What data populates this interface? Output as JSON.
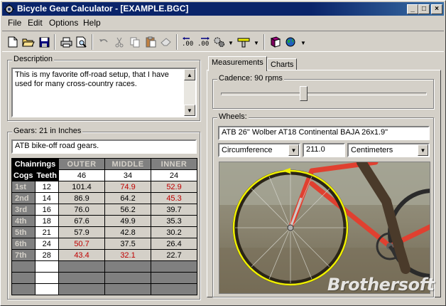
{
  "window": {
    "title": "Bicycle Gear Calculator - [EXAMPLE.BGC]"
  },
  "menu": [
    "File",
    "Edit",
    "Options",
    "Help"
  ],
  "toolbar": {
    "icons": [
      "new-icon",
      "open-folder-icon",
      "save-icon",
      "print-icon",
      "print-preview-icon",
      "undo-icon",
      "cut-icon",
      "copy-icon",
      "paste-icon",
      "eraser-icon",
      "decimal-left-icon",
      "decimal-right-icon",
      "gears-icon",
      "bicycle-icon",
      "book-icon",
      "globe-icon"
    ]
  },
  "description": {
    "label": "Description",
    "text": "This is my favorite off-road setup, that I have used for many cross-country races."
  },
  "gears": {
    "label": "Gears: 21 in Inches",
    "name": "ATB bike-off road gears.",
    "header_chainrings": "Chainrings",
    "header_cogs": "Cogs",
    "header_teeth": "Teeth",
    "chainrings": [
      {
        "name": "OUTER",
        "teeth": "46"
      },
      {
        "name": "MIDDLE",
        "teeth": "34"
      },
      {
        "name": "INNER",
        "teeth": "24"
      }
    ],
    "rows": [
      {
        "label": "1st",
        "cog": "12",
        "values": [
          "101.4",
          "74.9",
          "52.9"
        ],
        "red": [
          false,
          true,
          true
        ]
      },
      {
        "label": "2nd",
        "cog": "14",
        "values": [
          "86.9",
          "64.2",
          "45.3"
        ],
        "red": [
          false,
          false,
          true
        ]
      },
      {
        "label": "3rd",
        "cog": "16",
        "values": [
          "76.0",
          "56.2",
          "39.7"
        ],
        "red": [
          false,
          false,
          false
        ]
      },
      {
        "label": "4th",
        "cog": "18",
        "values": [
          "67.6",
          "49.9",
          "35.3"
        ],
        "red": [
          false,
          false,
          false
        ]
      },
      {
        "label": "5th",
        "cog": "21",
        "values": [
          "57.9",
          "42.8",
          "30.2"
        ],
        "red": [
          false,
          false,
          false
        ]
      },
      {
        "label": "6th",
        "cog": "24",
        "values": [
          "50.7",
          "37.5",
          "26.4"
        ],
        "red": [
          true,
          false,
          false
        ]
      },
      {
        "label": "7th",
        "cog": "28",
        "values": [
          "43.4",
          "32.1",
          "22.7"
        ],
        "red": [
          true,
          true,
          false
        ]
      }
    ],
    "empty_rows": 3
  },
  "tabs": {
    "measurements": "Measurements",
    "charts": "Charts"
  },
  "cadence": {
    "label": "Cadence: 90 rpms",
    "level": 0.4
  },
  "wheels": {
    "label": "Wheels:",
    "name": "ATB 26\" Wolber AT18 Continental BAJA 26x1.9\"",
    "measure_type": "Circumference",
    "value": "211.0",
    "unit": "Centimeters"
  },
  "watermark": "Brothersoft",
  "colors": {
    "title_bar": "#0a246a",
    "highlight_red": "#c00000",
    "wheel_circle": "#f0f000"
  }
}
